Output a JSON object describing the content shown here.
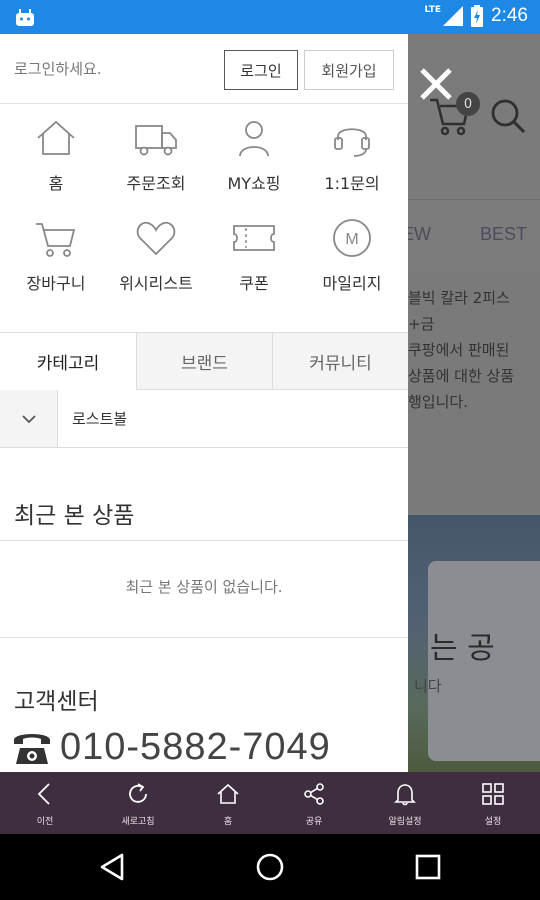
{
  "status_bar": {
    "network_label": "LTE",
    "time": "2:46"
  },
  "drawer": {
    "login_prompt": "로그인하세요.",
    "login_button": "로그인",
    "join_button": "회원가입",
    "quick_menu": [
      {
        "label": "홈",
        "icon": "home-icon"
      },
      {
        "label": "주문조회",
        "icon": "truck-icon"
      },
      {
        "label": "MY쇼핑",
        "icon": "person-icon"
      },
      {
        "label": "1:1문의",
        "icon": "headset-icon"
      },
      {
        "label": "장바구니",
        "icon": "cart-icon"
      },
      {
        "label": "위시리스트",
        "icon": "heart-icon"
      },
      {
        "label": "쿠폰",
        "icon": "coupon-icon"
      },
      {
        "label": "마일리지",
        "icon": "mileage-icon"
      }
    ],
    "tabs": [
      "카테고리",
      "브랜드",
      "커뮤니티"
    ],
    "active_tab": "카테고리",
    "category": "로스트볼",
    "recent_title": "최근 본 상품",
    "recent_empty": "최근 본 상품이 없습니다.",
    "cs_title": "고객센터",
    "cs_phone": "010-5882-7049"
  },
  "background_page": {
    "cart_count": "0",
    "tabs": [
      "EW",
      "BEST"
    ],
    "text_lines": [
      "블빅 칼라 2피스",
      "+금",
      "쿠팡에서 판매된",
      "상품에 대한 상품",
      "행입니다."
    ],
    "banner_title": "는 공",
    "banner_sub": "니다"
  },
  "app_bar": [
    {
      "label": "이전",
      "icon": "back-icon"
    },
    {
      "label": "새로고침",
      "icon": "refresh-icon"
    },
    {
      "label": "홈",
      "icon": "home-icon"
    },
    {
      "label": "공유",
      "icon": "share-icon"
    },
    {
      "label": "알림설정",
      "icon": "bell-icon"
    },
    {
      "label": "설정",
      "icon": "grid-icon"
    }
  ],
  "colors": {
    "status_bar": "#1e88e5",
    "app_bar": "#3f2e3f"
  }
}
